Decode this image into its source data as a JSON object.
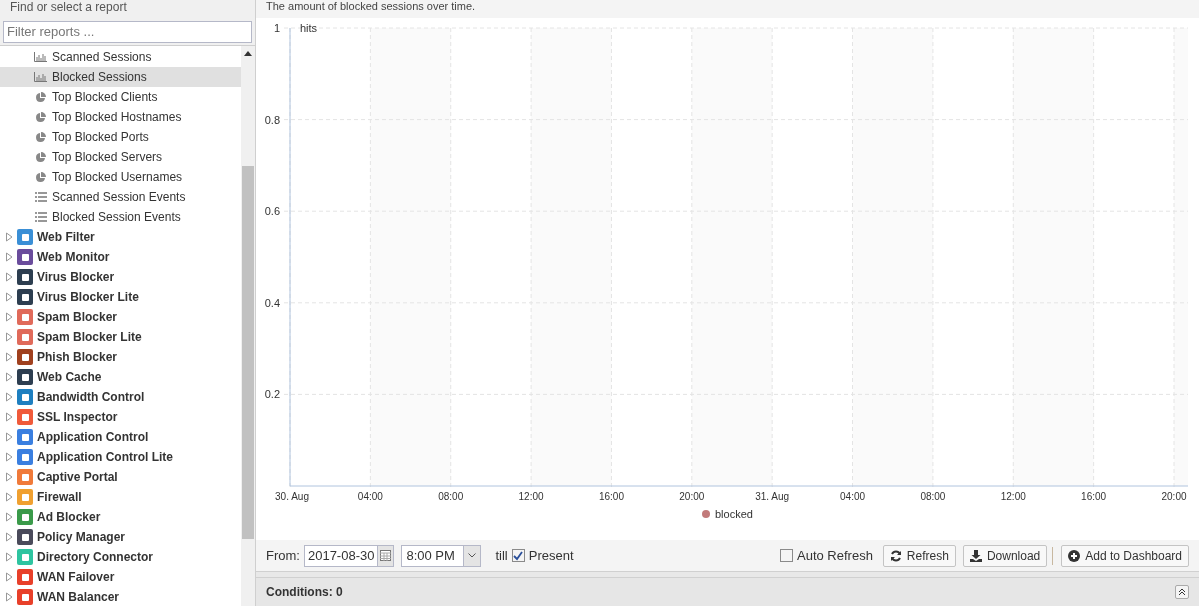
{
  "sidebar": {
    "title": "Find or select a report",
    "filter": {
      "placeholder": "Filter reports ..."
    },
    "tree": {
      "reports": [
        {
          "label": "Scanned Sessions",
          "kind": "bar",
          "selected": false
        },
        {
          "label": "Blocked Sessions",
          "kind": "bar",
          "selected": true
        },
        {
          "label": "Top Blocked Clients",
          "kind": "pie",
          "selected": false
        },
        {
          "label": "Top Blocked Hostnames",
          "kind": "pie",
          "selected": false
        },
        {
          "label": "Top Blocked Ports",
          "kind": "pie",
          "selected": false
        },
        {
          "label": "Top Blocked Servers",
          "kind": "pie",
          "selected": false
        },
        {
          "label": "Top Blocked Usernames",
          "kind": "pie",
          "selected": false
        },
        {
          "label": "Scanned Session Events",
          "kind": "list",
          "selected": false
        },
        {
          "label": "Blocked Session Events",
          "kind": "list",
          "selected": false
        }
      ],
      "apps": [
        {
          "label": "Web Filter",
          "color": "#3a8fd6",
          "expanded": false
        },
        {
          "label": "Web Monitor",
          "color": "#6a4c9c",
          "expanded": false
        },
        {
          "label": "Virus Blocker",
          "color": "#2d3e50",
          "expanded": false
        },
        {
          "label": "Virus Blocker Lite",
          "color": "#2d3e50",
          "expanded": false
        },
        {
          "label": "Spam Blocker",
          "color": "#e06a5a",
          "expanded": false
        },
        {
          "label": "Spam Blocker Lite",
          "color": "#e06a5a",
          "expanded": false
        },
        {
          "label": "Phish Blocker",
          "color": "#a0401e",
          "expanded": false
        },
        {
          "label": "Web Cache",
          "color": "#2d3e50",
          "expanded": false
        },
        {
          "label": "Bandwidth Control",
          "color": "#1e7fc0",
          "expanded": false
        },
        {
          "label": "SSL Inspector",
          "color": "#f05a3a",
          "expanded": false
        },
        {
          "label": "Application Control",
          "color": "#3a7fe0",
          "expanded": false
        },
        {
          "label": "Application Control Lite",
          "color": "#3a7fe0",
          "expanded": false
        },
        {
          "label": "Captive Portal",
          "color": "#f07a3a",
          "expanded": false
        },
        {
          "label": "Firewall",
          "color": "#f0a030",
          "expanded": false
        },
        {
          "label": "Ad Blocker",
          "color": "#3a9a4a",
          "expanded": false
        },
        {
          "label": "Policy Manager",
          "color": "#4a4a5a",
          "expanded": false
        },
        {
          "label": "Directory Connector",
          "color": "#2ec4a0",
          "expanded": false
        },
        {
          "label": "WAN Failover",
          "color": "#e8402a",
          "expanded": false
        },
        {
          "label": "WAN Balancer",
          "color": "#e8402a",
          "expanded": false
        }
      ]
    }
  },
  "report": {
    "description": "The amount of blocked sessions over time.",
    "chart_data": {
      "type": "line",
      "ylabel": "hits",
      "ylim": [
        0,
        1
      ],
      "yticks": [
        0.2,
        0.4,
        0.6,
        0.8,
        1
      ],
      "categories": [
        "30. Aug",
        "04:00",
        "08:00",
        "12:00",
        "16:00",
        "20:00",
        "31. Aug",
        "04:00",
        "08:00",
        "12:00",
        "16:00",
        "20:00"
      ],
      "grid": true,
      "series": [
        {
          "name": "blocked",
          "color": "#c27a7a",
          "values": [
            null,
            null,
            null,
            null,
            null,
            null,
            null,
            null,
            null,
            null,
            null,
            null
          ]
        }
      ]
    },
    "toolbar": {
      "from_label": "From:",
      "date": "2017-08-30",
      "time": "8:00 PM",
      "till_label": "till",
      "present": {
        "label": "Present",
        "checked": true
      },
      "auto_refresh": {
        "label": "Auto Refresh",
        "checked": false
      },
      "buttons": [
        {
          "label": "Refresh",
          "kind": "refresh"
        },
        {
          "label": "Download",
          "kind": "download"
        },
        {
          "label": "Add to Dashboard",
          "kind": "add"
        }
      ]
    }
  },
  "conditions": {
    "title": "Conditions: 0"
  }
}
